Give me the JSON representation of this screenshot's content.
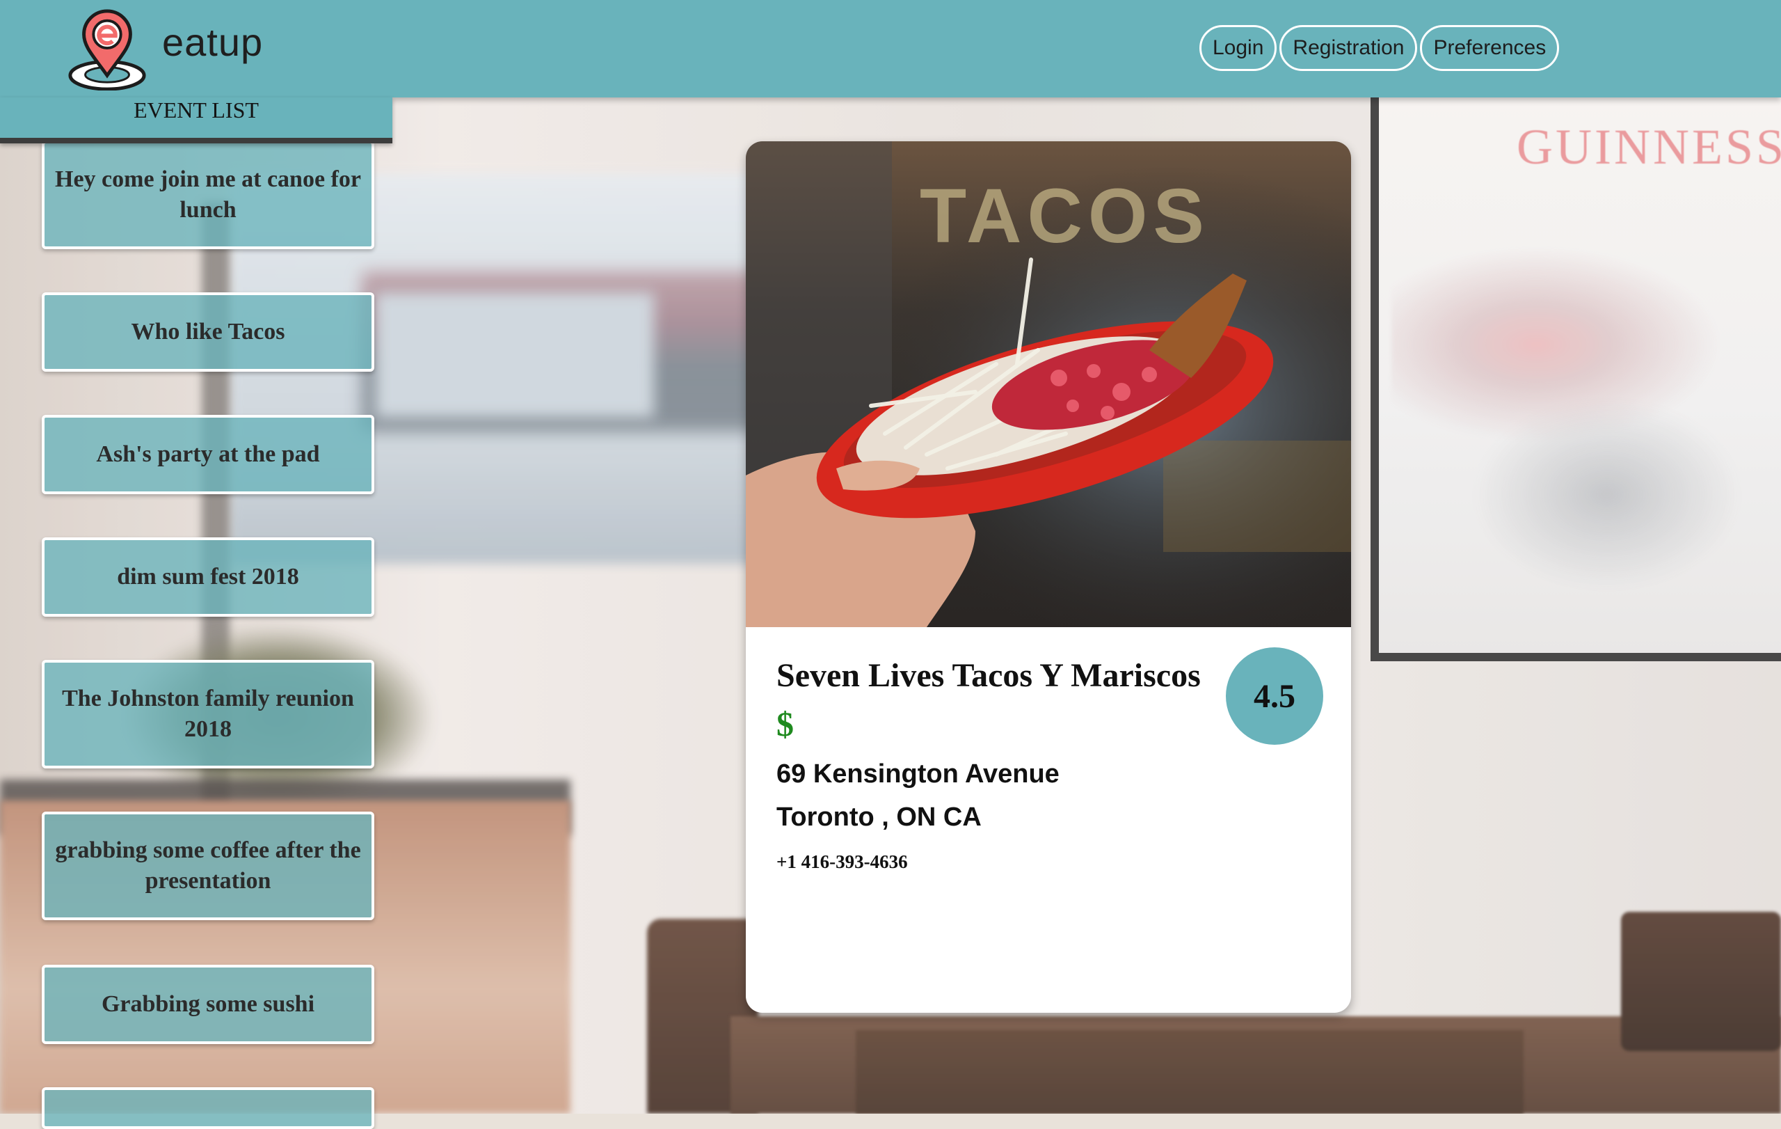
{
  "header": {
    "brand": "eatup",
    "nav": [
      {
        "label": "Login"
      },
      {
        "label": "Registration"
      },
      {
        "label": "Preferences"
      }
    ]
  },
  "event_list": {
    "title": "EVENT LIST",
    "events": [
      {
        "label": "Hey come join me at canoe for lunch"
      },
      {
        "label": "Who like Tacos"
      },
      {
        "label": "Ash's party at the pad"
      },
      {
        "label": "dim sum fest 2018"
      },
      {
        "label": "The Johnston family reunion 2018"
      },
      {
        "label": "grabbing some coffee after the presentation"
      },
      {
        "label": "Grabbing some sushi"
      },
      {
        "label": ""
      }
    ]
  },
  "restaurant": {
    "name": "Seven Lives Tacos Y Mariscos",
    "price": "$",
    "rating": "4.5",
    "address_line1": "69 Kensington Avenue",
    "address_line2": "Toronto , ON CA",
    "phone": "+1 416-393-4636",
    "photo_sign_text": "TACOS"
  },
  "background": {
    "poster_text": "GUINNESS"
  },
  "colors": {
    "accent": "#69b3bb",
    "price_green": "#1f8a1f"
  }
}
